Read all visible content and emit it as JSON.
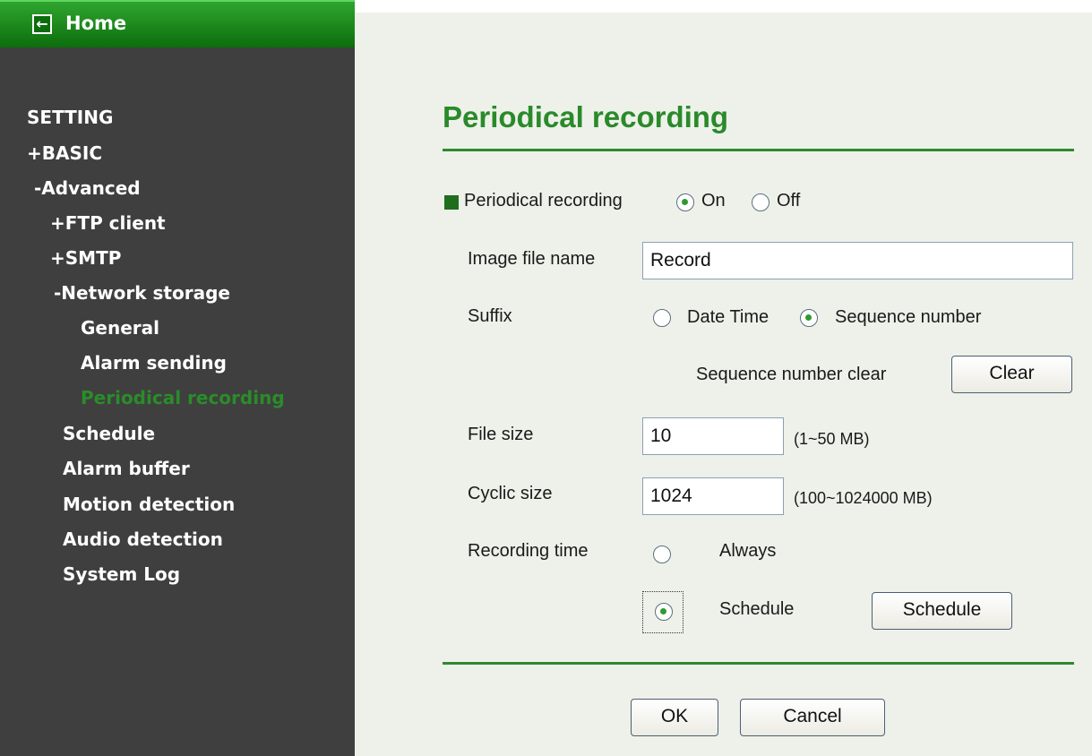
{
  "sidebar": {
    "home_label": "Home",
    "home_icon": "arrow-left-icon",
    "items": [
      {
        "label": "SETTING"
      },
      {
        "label": "+BASIC"
      },
      {
        "label": "-Advanced"
      },
      {
        "label": "+FTP client"
      },
      {
        "label": "+SMTP"
      },
      {
        "label": "-Network storage"
      },
      {
        "label": "General"
      },
      {
        "label": "Alarm sending"
      },
      {
        "label": "Periodical recording",
        "active": true
      },
      {
        "label": "Schedule"
      },
      {
        "label": "Alarm buffer"
      },
      {
        "label": "Motion detection"
      },
      {
        "label": "Audio detection"
      },
      {
        "label": "System Log"
      }
    ]
  },
  "main": {
    "title": "Periodical recording",
    "section_label": "Periodical recording",
    "on_label": "On",
    "off_label": "Off",
    "periodical_recording": "On",
    "image_file_name_label": "Image file name",
    "image_file_name_value": "Record",
    "suffix_label": "Suffix",
    "suffix_date_time_label": "Date Time",
    "suffix_sequence_label": "Sequence number",
    "suffix_selected": "Sequence number",
    "sequence_clear_label": "Sequence number clear",
    "clear_button": "Clear",
    "file_size_label": "File size",
    "file_size_value": "10",
    "file_size_range": "(1~50 MB)",
    "cyclic_size_label": "Cyclic size",
    "cyclic_size_value": "1024",
    "cyclic_size_range": "(100~1024000 MB)",
    "recording_time_label": "Recording time",
    "always_label": "Always",
    "schedule_label": "Schedule",
    "recording_time_selected": "Schedule",
    "schedule_button": "Schedule",
    "ok_button": "OK",
    "cancel_button": "Cancel"
  },
  "colors": {
    "accent_green": "#2a8a2a",
    "sidebar_bg": "#3f3f3f",
    "content_bg": "#eef1ea"
  }
}
